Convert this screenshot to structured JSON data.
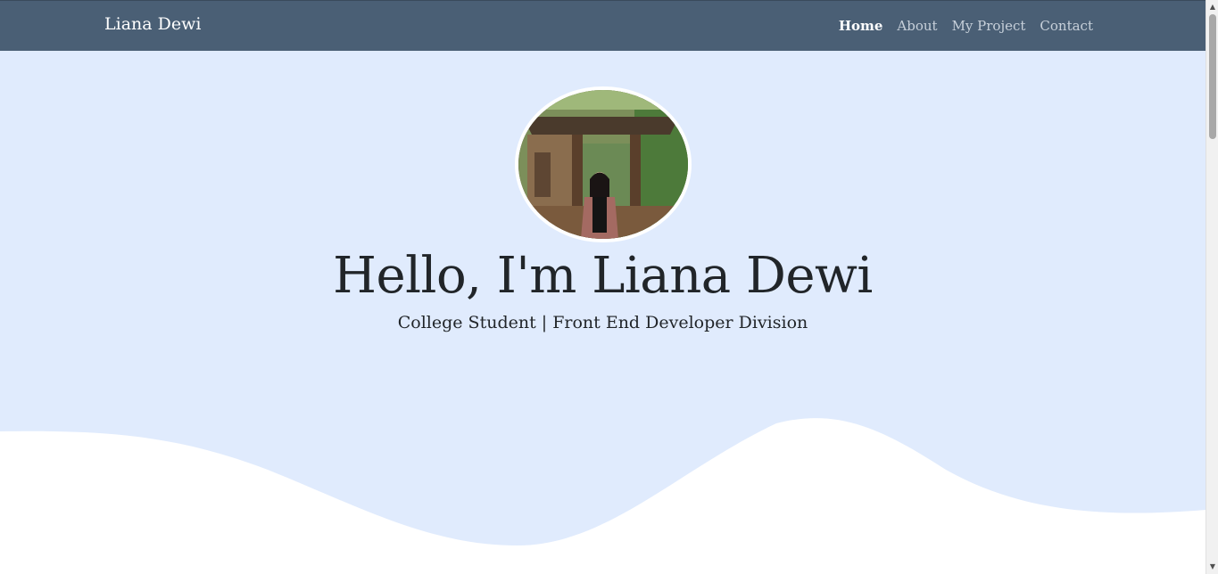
{
  "navbar": {
    "brand": "Liana Dewi",
    "links": [
      {
        "label": "Home",
        "active": true
      },
      {
        "label": "About",
        "active": false
      },
      {
        "label": "My Project",
        "active": false
      },
      {
        "label": "Contact",
        "active": false
      }
    ]
  },
  "hero": {
    "title": "Hello, I'm Liana Dewi",
    "subtitle": "College Student | Front End Developer Division",
    "avatar_icon": "profile-photo"
  },
  "colors": {
    "navbar_bg": "#4a5f75",
    "hero_bg": "#e0ebfd",
    "wave": "#ffffff",
    "text": "#212529"
  }
}
